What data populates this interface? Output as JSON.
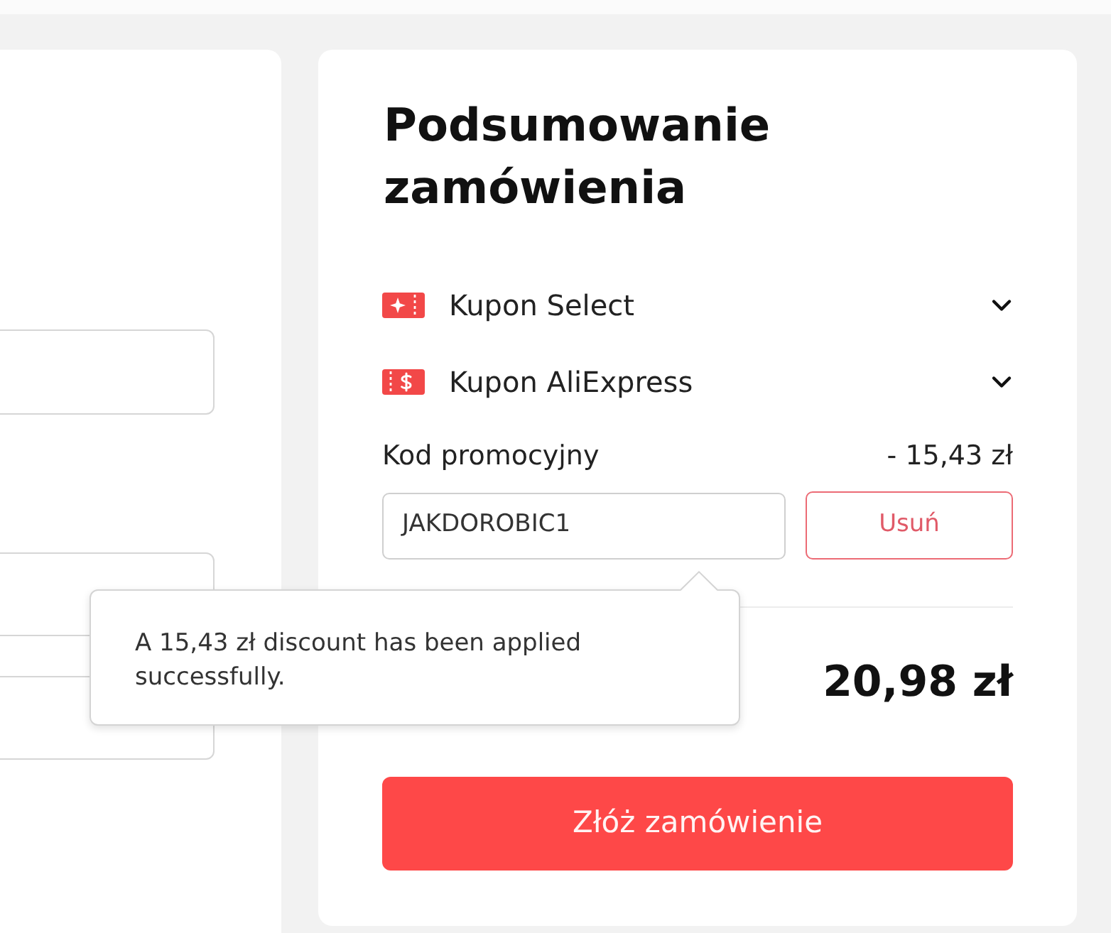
{
  "summary": {
    "title": "Podsumowanie zamówienia",
    "coupons": [
      {
        "kind": "select",
        "label": "Kupon Select",
        "expanded": false
      },
      {
        "kind": "aliexpress",
        "label": "Kupon AliExpress",
        "expanded": false
      }
    ],
    "promo": {
      "label": "Kod promocyjny",
      "discount": "- 15,43 zł",
      "value": "JAKDOROBIC1",
      "remove_button": "Usuń"
    },
    "total": "20,98 zł",
    "order_button": "Złóż zamówienie"
  },
  "tooltip": {
    "message": "A 15,43 zł discount has been applied successfully."
  }
}
